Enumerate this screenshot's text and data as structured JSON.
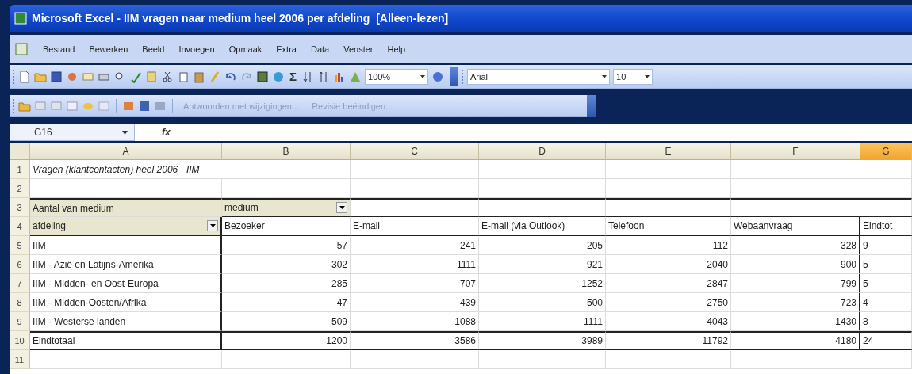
{
  "window": {
    "title": "Microsoft Excel - IIM vragen naar medium heel 2006 per afdeling  [Alleen-lezen]"
  },
  "menu": [
    "Bestand",
    "Bewerken",
    "Beeld",
    "Invoegen",
    "Opmaak",
    "Extra",
    "Data",
    "Venster",
    "Help"
  ],
  "toolbar": {
    "sum": "Σ",
    "zoom": "100%",
    "font": "Arial",
    "size": "10"
  },
  "review_toolbar": [
    {
      "label": "Antwoorden met wijzigingen...",
      "disabled": true
    },
    {
      "label": "Revisie beëindigen...",
      "disabled": true
    }
  ],
  "formula_bar": {
    "name_box": "G16",
    "fx": "fx"
  },
  "columns": [
    {
      "label": "A",
      "selected": false
    },
    {
      "label": "B",
      "selected": false
    },
    {
      "label": "C",
      "selected": false
    },
    {
      "label": "D",
      "selected": false
    },
    {
      "label": "E",
      "selected": false
    },
    {
      "label": "F",
      "selected": false
    },
    {
      "label": "G",
      "selected": true
    }
  ],
  "rows": [
    {
      "number": "1",
      "kind": "plain",
      "cells": [
        {
          "text": "Vragen (klantcontacten) heel 2006 - IIM",
          "kind": "title"
        }
      ]
    },
    {
      "number": "2",
      "kind": "plain",
      "cells": []
    },
    {
      "number": "3",
      "kind": "pivot-top",
      "cells": [
        {
          "text": "Aantal van medium",
          "kind": "field"
        },
        {
          "text": "medium",
          "kind": "field-dropdown"
        }
      ]
    },
    {
      "number": "4",
      "kind": "pivot-head",
      "cells": [
        {
          "text": "afdeling",
          "kind": "field-dropdown"
        },
        {
          "text": "Bezoeker",
          "kind": "text"
        },
        {
          "text": "E-mail",
          "kind": "text"
        },
        {
          "text": "E-mail (via Outlook)",
          "kind": "text"
        },
        {
          "text": "Telefoon",
          "kind": "text"
        },
        {
          "text": "Webaanvraag",
          "kind": "text"
        },
        {
          "text": "Eindtot",
          "kind": "text"
        }
      ]
    },
    {
      "number": "5",
      "kind": "pivot-data",
      "cells": [
        {
          "text": "IIM",
          "kind": "text"
        },
        {
          "text": "57",
          "kind": "number"
        },
        {
          "text": "241",
          "kind": "number"
        },
        {
          "text": "205",
          "kind": "number"
        },
        {
          "text": "112",
          "kind": "number"
        },
        {
          "text": "328",
          "kind": "number"
        },
        {
          "text": "9",
          "kind": "number"
        }
      ]
    },
    {
      "number": "6",
      "kind": "pivot-data",
      "cells": [
        {
          "text": "IIM - Azië en Latijns-Amerika",
          "kind": "text"
        },
        {
          "text": "302",
          "kind": "number"
        },
        {
          "text": "1111",
          "kind": "number"
        },
        {
          "text": "921",
          "kind": "number"
        },
        {
          "text": "2040",
          "kind": "number"
        },
        {
          "text": "900",
          "kind": "number"
        },
        {
          "text": "5",
          "kind": "number"
        }
      ]
    },
    {
      "number": "7",
      "kind": "pivot-data",
      "cells": [
        {
          "text": "IIM - Midden- en Oost-Europa",
          "kind": "text"
        },
        {
          "text": "285",
          "kind": "number"
        },
        {
          "text": "707",
          "kind": "number"
        },
        {
          "text": "1252",
          "kind": "number"
        },
        {
          "text": "2847",
          "kind": "number"
        },
        {
          "text": "799",
          "kind": "number"
        },
        {
          "text": "5",
          "kind": "number"
        }
      ]
    },
    {
      "number": "8",
      "kind": "pivot-data",
      "cells": [
        {
          "text": "IIM - Midden-Oosten/Afrika",
          "kind": "text"
        },
        {
          "text": "47",
          "kind": "number"
        },
        {
          "text": "439",
          "kind": "number"
        },
        {
          "text": "500",
          "kind": "number"
        },
        {
          "text": "2750",
          "kind": "number"
        },
        {
          "text": "723",
          "kind": "number"
        },
        {
          "text": "4",
          "kind": "number"
        }
      ]
    },
    {
      "number": "9",
      "kind": "pivot-data",
      "cells": [
        {
          "text": "IIM - Westerse landen",
          "kind": "text"
        },
        {
          "text": "509",
          "kind": "number"
        },
        {
          "text": "1088",
          "kind": "number"
        },
        {
          "text": "1111",
          "kind": "number"
        },
        {
          "text": "4043",
          "kind": "number"
        },
        {
          "text": "1430",
          "kind": "number"
        },
        {
          "text": "8",
          "kind": "number"
        }
      ]
    },
    {
      "number": "10",
      "kind": "pivot-total",
      "cells": [
        {
          "text": "Eindtotaal",
          "kind": "text"
        },
        {
          "text": "1200",
          "kind": "number"
        },
        {
          "text": "3586",
          "kind": "number"
        },
        {
          "text": "3989",
          "kind": "number"
        },
        {
          "text": "11792",
          "kind": "number"
        },
        {
          "text": "4180",
          "kind": "number"
        },
        {
          "text": "24",
          "kind": "number"
        }
      ]
    },
    {
      "number": "11",
      "kind": "plain",
      "cells": []
    }
  ]
}
